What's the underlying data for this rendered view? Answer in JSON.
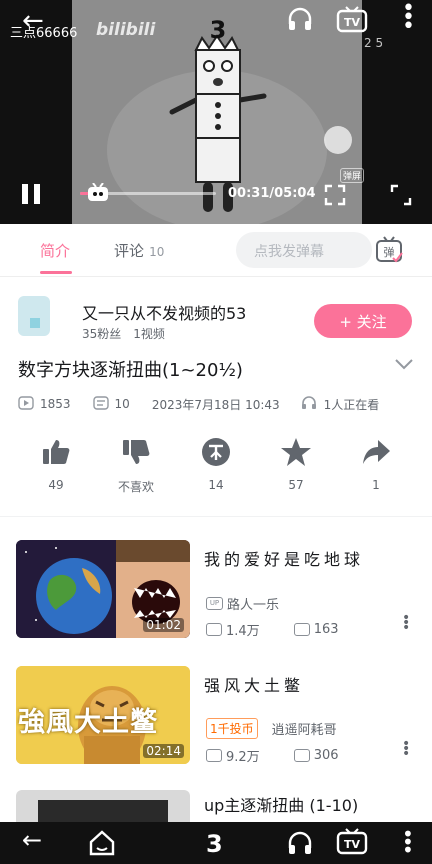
{
  "player": {
    "overlay_user": "三点66666",
    "watermark": "bilibili",
    "number_on_screen": "3",
    "page_indicator": "2 5",
    "time": "00:31/05:04",
    "danmaku_button": "弹屏",
    "progress_fraction": 0.1
  },
  "tabs": {
    "intro": "简介",
    "comments": "评论",
    "comment_count": "10",
    "danmaku_placeholder": "点我发弹幕",
    "danmaku_icon_text": "弹"
  },
  "uploader": {
    "name": "又一只从不发视频的53",
    "fans": "35粉丝",
    "videos": "1视频",
    "follow": "+ 关注"
  },
  "video": {
    "title": "数字方块逐渐扭曲(1~20½)",
    "views": "1853",
    "danmaku": "10",
    "date": "2023年7月18日 10:43",
    "watching": "1人正在看"
  },
  "actions": [
    {
      "icon": "thumb-up-icon",
      "label": "49"
    },
    {
      "icon": "thumb-down-icon",
      "label": "不喜欢"
    },
    {
      "icon": "coin-icon",
      "label": "14"
    },
    {
      "icon": "star-icon",
      "label": "57"
    },
    {
      "icon": "share-icon",
      "label": "1"
    }
  ],
  "recommendations": [
    {
      "title": "我的爱好是吃地球",
      "author": "路人一乐",
      "views": "1.4万",
      "danmaku": "163",
      "duration": "01:02",
      "badge": ""
    },
    {
      "title": "强风大土鳖",
      "author": "逍遥阿耗哥",
      "views": "9.2万",
      "danmaku": "306",
      "duration": "02:14",
      "badge": "1千投币",
      "thumb_text": "強風大土鳖"
    },
    {
      "title": "up主逐渐扭曲 (1-10)"
    }
  ],
  "colors": {
    "accent": "#fb7299"
  }
}
